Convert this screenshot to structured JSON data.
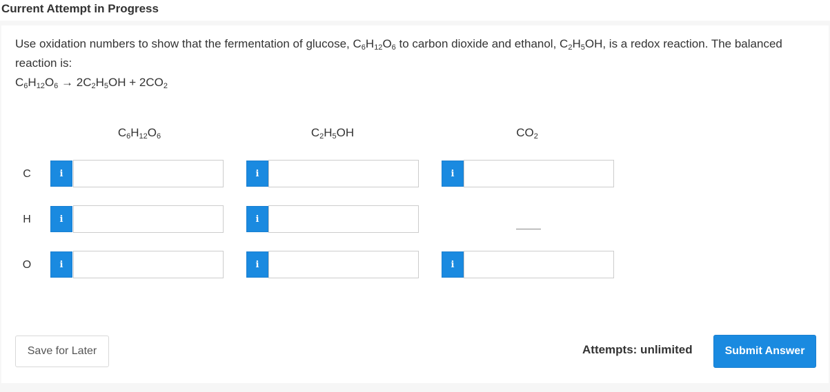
{
  "header": {
    "title": "Current Attempt in Progress"
  },
  "question": {
    "text_part1": "Use oxidation numbers to show that the fermentation of glucose, C",
    "sub1": "6",
    "mid1": "H",
    "sub2": "12",
    "mid2": "O",
    "sub3": "6",
    "text_part2": " to carbon dioxide and ethanol, C",
    "sub4": "2",
    "mid3": "H",
    "sub5": "5",
    "text_part3": "OH, is a redox reaction. The balanced reaction is:",
    "equation": {
      "r1": "C",
      "r1s": "6",
      "r2": "H",
      "r2s": "12",
      "r3": "O",
      "r3s": "6",
      "arrow": " → ",
      "p1": "2C",
      "p1s": "2",
      "p2": "H",
      "p2s": "5",
      "p3": "OH + 2CO",
      "p3s": "2"
    }
  },
  "columns": [
    {
      "a": "C",
      "as": "6",
      "b": "H",
      "bs": "12",
      "c": "O",
      "cs": "6"
    },
    {
      "a": "C",
      "as": "2",
      "b": "H",
      "bs": "5",
      "c": "OH",
      "cs": ""
    },
    {
      "a": "CO",
      "as": "2",
      "b": "",
      "bs": "",
      "c": "",
      "cs": ""
    }
  ],
  "rows": [
    {
      "label": "C"
    },
    {
      "label": "H"
    },
    {
      "label": "O"
    }
  ],
  "inputs": {
    "c_glucose": "",
    "c_ethanol": "",
    "c_co2": "",
    "h_glucose": "",
    "h_ethanol": "",
    "o_glucose": "",
    "o_ethanol": "",
    "o_co2": ""
  },
  "info_icon": {
    "glyph": "i",
    "icon": "info-icon",
    "color": "#1a8ae0"
  },
  "footer": {
    "save_label": "Save for Later",
    "attempts_label": "Attempts: unlimited",
    "submit_label": "Submit Answer"
  }
}
